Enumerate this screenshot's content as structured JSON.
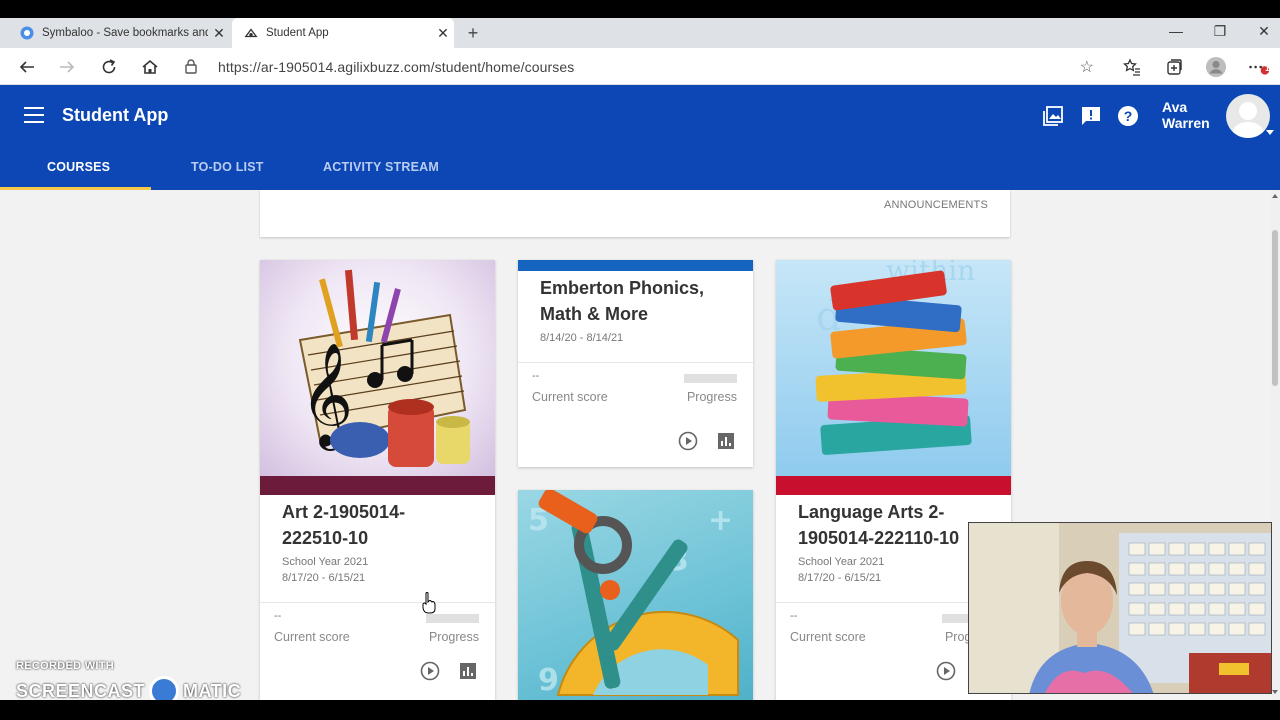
{
  "browser": {
    "tabs": [
      {
        "title": "Symbaloo - Save bookmarks and",
        "close": "✕"
      },
      {
        "title": "Student App",
        "close": "✕"
      }
    ],
    "new_tab": "+",
    "window_controls": {
      "minimize": "—",
      "maximize": "❐",
      "close": "✕"
    },
    "url": "https://ar-1905014.agilixbuzz.com/student/home/courses",
    "notification_badge": "1"
  },
  "app": {
    "title": "Student App",
    "user_first": "Ava",
    "user_last": "Warren",
    "nav_tabs": [
      {
        "label": "COURSES",
        "active": true
      },
      {
        "label": "TO-DO LIST",
        "active": false
      },
      {
        "label": "ACTIVITY STREAM",
        "active": false
      }
    ],
    "accent_color": "#0d47b5",
    "underline_color": "#f7c948"
  },
  "announcements": {
    "link": "ANNOUNCEMENTS"
  },
  "courses": [
    {
      "title_line1": "Art 2-1905014-",
      "title_line2": "222510-10",
      "school_year": "School Year 2021",
      "dates": "8/17/20 - 6/15/21",
      "score_value": "--",
      "score_label": "Current score",
      "progress_label": "Progress",
      "band_color": "#6d1b3b"
    },
    {
      "title_line1": "Emberton Phonics,",
      "title_line2": "Math & More",
      "dates": "8/14/20 - 8/14/21",
      "score_value": "--",
      "score_label": "Current score",
      "progress_label": "Progress",
      "band_color": "#1565c0"
    },
    {
      "title_line1": "Language Arts 2-",
      "title_line2": "1905014-222110-10",
      "school_year": "School Year 2021",
      "dates": "8/17/20 - 6/15/21",
      "score_value": "--",
      "score_label": "Current score",
      "progress_label": "Progress",
      "band_color": "#c8102e"
    }
  ],
  "watermark": {
    "recorded_with": "RECORDED WITH",
    "left_word": "SCREENCAST",
    "right_word": "MATIC"
  }
}
